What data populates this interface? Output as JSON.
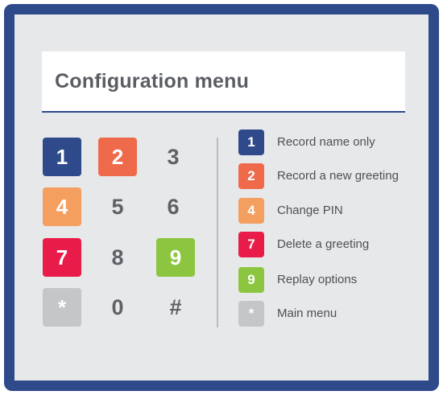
{
  "title": "Configuration menu",
  "colors": {
    "frame": "#2f4a8a",
    "navy": "#2f4a8a",
    "red_orange": "#ef6a4a",
    "orange": "#f49e60",
    "crimson": "#e81b49",
    "green": "#8cc640",
    "gray": "#c5c6c8"
  },
  "keypad": [
    {
      "label": "1",
      "color": "#2f4a8a"
    },
    {
      "label": "2",
      "color": "#ef6a4a"
    },
    {
      "label": "3",
      "color": null
    },
    {
      "label": "4",
      "color": "#f49e60"
    },
    {
      "label": "5",
      "color": null
    },
    {
      "label": "6",
      "color": null
    },
    {
      "label": "7",
      "color": "#e81b49"
    },
    {
      "label": "8",
      "color": null
    },
    {
      "label": "9",
      "color": "#8cc640"
    },
    {
      "label": "*",
      "color": "#c5c6c8"
    },
    {
      "label": "0",
      "color": null
    },
    {
      "label": "#",
      "color": null
    }
  ],
  "options": [
    {
      "key": "1",
      "label": "Record name only",
      "color": "#2f4a8a"
    },
    {
      "key": "2",
      "label": "Record a new greeting",
      "color": "#ef6a4a"
    },
    {
      "key": "4",
      "label": "Change PIN",
      "color": "#f49e60"
    },
    {
      "key": "7",
      "label": "Delete a greeting",
      "color": "#e81b49"
    },
    {
      "key": "9",
      "label": "Replay options",
      "color": "#8cc640"
    },
    {
      "key": "*",
      "label": "Main menu",
      "color": "#c5c6c8"
    }
  ]
}
